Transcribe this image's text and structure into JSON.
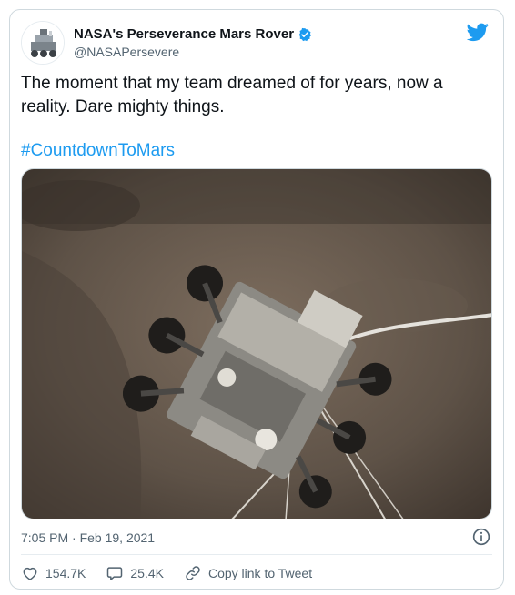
{
  "tweet": {
    "display_name": "NASA's Perseverance Mars Rover",
    "handle": "@NASAPersevere",
    "text": "The moment that my team dreamed of for years, now a reality. Dare mighty things.",
    "hashtag": "#CountdownToMars",
    "timestamp": "7:05 PM · Feb 19, 2021",
    "likes": "154.7K",
    "replies": "25.4K",
    "copy_link": "Copy link to Tweet"
  },
  "colors": {
    "twitter_blue": "#1d9bf0",
    "verified_blue": "#1d9bf0",
    "muted_text": "#536471"
  },
  "icons": {
    "brand": "twitter-bird-icon",
    "verified": "verified-badge-icon",
    "info": "info-icon",
    "like": "heart-icon",
    "reply": "speech-bubble-icon",
    "link": "link-icon"
  }
}
